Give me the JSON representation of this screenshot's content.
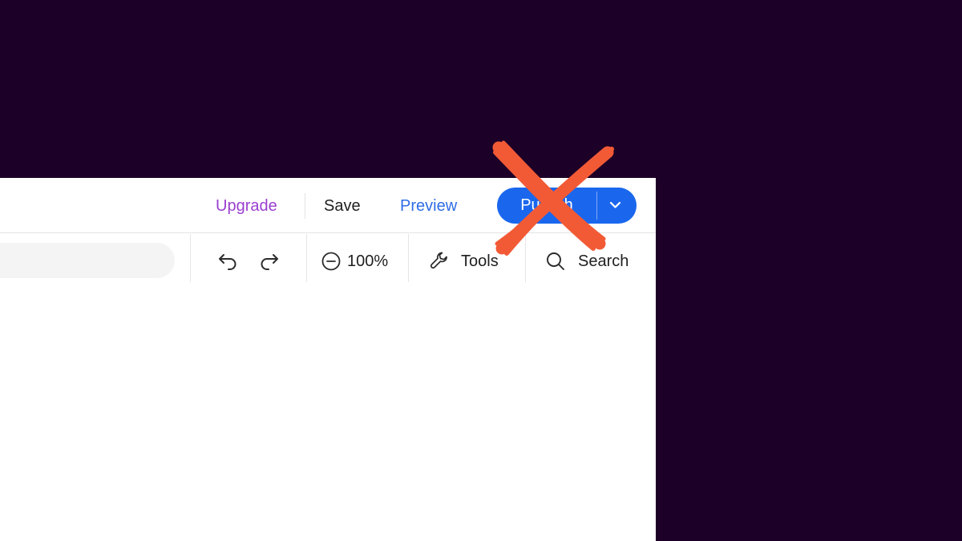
{
  "header": {
    "upgrade_label": "Upgrade",
    "save_label": "Save",
    "preview_label": "Preview",
    "publish_label": "Publish"
  },
  "toolbar": {
    "zoom_label": "100%",
    "tools_label": "Tools",
    "search_label": "Search"
  },
  "colors": {
    "background": "#1d0027",
    "upgrade": "#9a3fd0",
    "preview": "#2f6ee5",
    "publish_button": "#1a67ee",
    "cross_mark": "#f25a36"
  },
  "icons": {
    "undo": "undo-icon",
    "redo": "redo-icon",
    "zoom_out": "zoom-out-icon",
    "tools": "wrench-icon",
    "search": "search-icon",
    "publish_dropdown": "chevron-down-icon",
    "overlay": "cross-mark-icon"
  }
}
